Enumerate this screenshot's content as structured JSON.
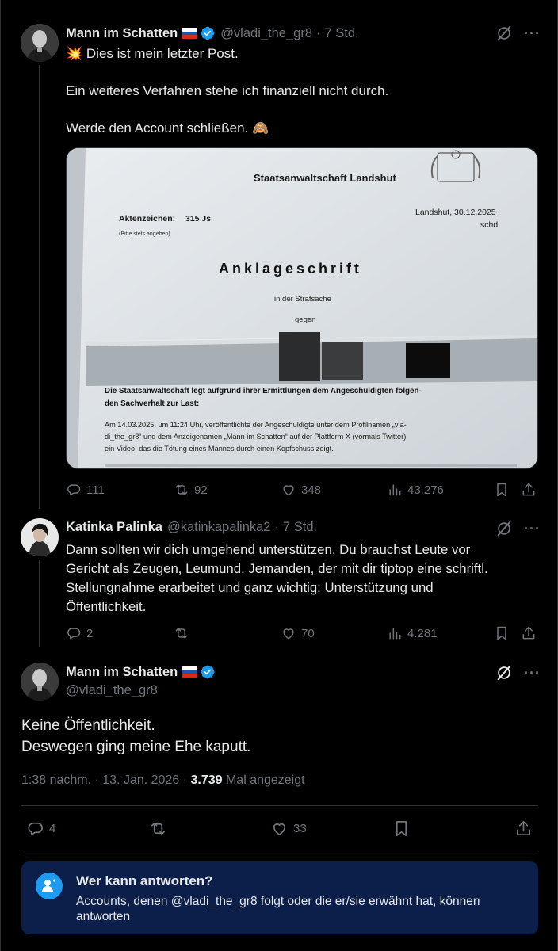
{
  "post1": {
    "author_name": "Mann im Schatten",
    "handle": "@vladi_the_gr8",
    "dot": "·",
    "time": "7 Std.",
    "emoji": "💥",
    "line1": "Dies ist mein letzter Post.",
    "line2": "Ein weiteres Verfahren stehe ich finanziell nicht durch.",
    "line3": "Werde den Account schließen. 🙈",
    "document": {
      "office": "Staatsanwaltschaft Landshut",
      "file_label": "Aktenzeichen:",
      "file_no": "315 Js",
      "file_note": "(Bitte stets angeben)",
      "place_date": "Landshut, 30.12.2025",
      "initials": "schd",
      "heading": "Anklageschrift",
      "in_case": "in der Strafsache",
      "against": "gegen",
      "para1": "Die Staatsanwaltschaft legt aufgrund ihrer Ermittlungen dem Angeschuldigten folgen-",
      "para1b": "den Sachverhalt zur Last:",
      "para2a": "Am 14.03.2025, um 11:24 Uhr, veröffentlichte der Angeschuldigte unter dem Profilnamen „vla-",
      "para2b": "di_the_gr8“ und dem Anzeigenamen „Mann im Schatten“ auf der Plattform X (vormals Twitter)",
      "para2c": "ein Video, das die Tötung eines Mannes durch einen Kopfschuss zeigt."
    },
    "stats": {
      "replies": "111",
      "reposts": "92",
      "likes": "348",
      "views": "43.276"
    }
  },
  "post2": {
    "author_name": "Katinka Palinka",
    "handle": "@katinkapalinka2",
    "dot": "·",
    "time": "7 Std.",
    "line1": "Dann sollten wir dich umgehend unterstützen. Du brauchst Leute vor",
    "line2": "Gericht als Zeugen, Leumund. Jemanden, der mit dir tiptop eine schriftl.",
    "line3": "Stellungnahme erarbeitet und ganz wichtig: Unterstützung und",
    "line4": "Öffentlichkeit.",
    "stats": {
      "replies": "2",
      "likes": "70",
      "views": "4.281"
    }
  },
  "post3": {
    "author_name": "Mann im Schatten",
    "handle": "@vladi_the_gr8",
    "line1": "Keine Öffentlichkeit.",
    "line2": "Deswegen ging meine Ehe kaputt.",
    "timestamp": "1:38 nachm. · 13. Jan. 2026 · ",
    "view_count": "3.739",
    "view_suffix": " Mal angezeigt",
    "stats": {
      "replies": "4",
      "likes": "33"
    }
  },
  "reply_restriction": {
    "title": "Wer kann antworten?",
    "description": "Accounts, denen @vladi_the_gr8 folgt oder die er/sie erwähnt hat, können antworten"
  },
  "icons": {
    "verified": "verified-badge-icon",
    "grok": "grok-icon",
    "more": "more-icon",
    "reply": "reply-icon",
    "repost": "repost-icon",
    "like": "like-icon",
    "views": "views-icon",
    "bookmark": "bookmark-icon",
    "share": "share-icon",
    "who_can_reply": "person-mention-icon"
  },
  "colors": {
    "background": "#000000",
    "text": "#e7e9ea",
    "secondary": "#71767b",
    "accent": "#1d9bf0",
    "reply_box": "#0b1f4a"
  }
}
